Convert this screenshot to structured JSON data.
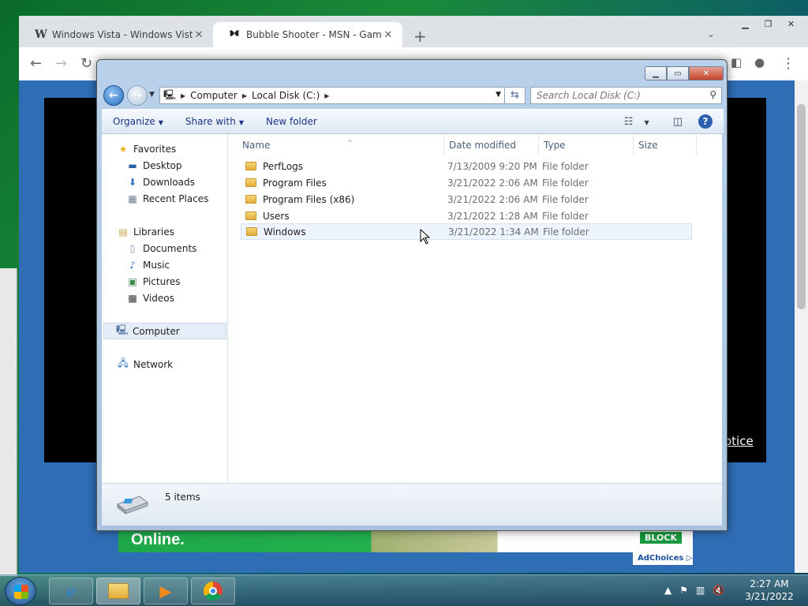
{
  "browser": {
    "tabs": [
      {
        "title": "Windows Vista - Windows Vista",
        "favicon": "W"
      },
      {
        "title": "Bubble Shooter - MSN - Game P",
        "favicon": "butterfly"
      }
    ],
    "tab_close": "✕",
    "new_tab": "+",
    "page": {
      "notice_text": "otice",
      "ad_text": "Online.",
      "ad_button": "BLOCK",
      "adchoices": "AdChoices"
    }
  },
  "explorer": {
    "breadcrumbs": [
      "Computer",
      "Local Disk (C:)"
    ],
    "search_placeholder": "Search Local Disk (C:)",
    "toolbar": {
      "organize": "Organize",
      "share_with": "Share with",
      "new_folder": "New folder"
    },
    "nav": {
      "favorites": "Favorites",
      "favorites_items": [
        "Desktop",
        "Downloads",
        "Recent Places"
      ],
      "libraries": "Libraries",
      "libraries_items": [
        "Documents",
        "Music",
        "Pictures",
        "Videos"
      ],
      "computer": "Computer",
      "network": "Network"
    },
    "columns": [
      "Name",
      "Date modified",
      "Type",
      "Size"
    ],
    "files": [
      {
        "name": "PerfLogs",
        "date": "7/13/2009 9:20 PM",
        "type": "File folder"
      },
      {
        "name": "Program Files",
        "date": "3/21/2022 2:06 AM",
        "type": "File folder"
      },
      {
        "name": "Program Files (x86)",
        "date": "3/21/2022 2:06 AM",
        "type": "File folder"
      },
      {
        "name": "Users",
        "date": "3/21/2022 1:28 AM",
        "type": "File folder"
      },
      {
        "name": "Windows",
        "date": "3/21/2022 1:34 AM",
        "type": "File folder"
      }
    ],
    "status": "5 items"
  },
  "taskbar": {
    "time": "2:27 AM",
    "date": "3/21/2022"
  },
  "colors": {
    "accent": "#1e3287",
    "chrome_frame": "#dee1e6",
    "page_bg": "#2f6db5"
  }
}
